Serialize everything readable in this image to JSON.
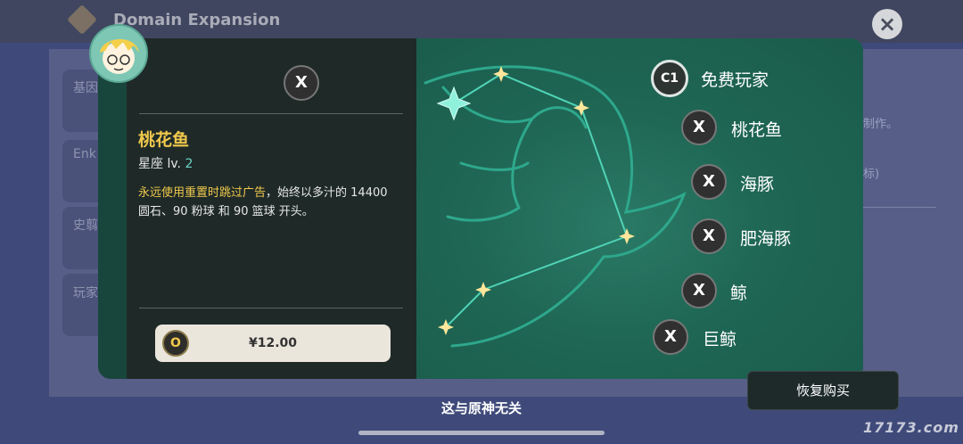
{
  "header": {
    "title": "Domain Expansion",
    "close_icon": "×"
  },
  "background": {
    "card_labels": [
      "基因",
      "Enk",
      "史翦",
      "玩家"
    ],
    "right_texts": [
      "制作。",
      "标)"
    ]
  },
  "detail": {
    "top_token": "X",
    "name": "桃花鱼",
    "level_label": "星座 lv.",
    "level_value": "2",
    "desc_highlight": "永远使用重置时跳过广告",
    "desc_rest": "，始终以多汁的 14400 圆石、90 粉球 和 90 篮球 开头。",
    "buy": {
      "token": "O",
      "price": "¥12.00"
    }
  },
  "constellation": {
    "items": [
      {
        "token": "C1",
        "label": "免费玩家"
      },
      {
        "token": "X",
        "label": "桃花鱼"
      },
      {
        "token": "X",
        "label": "海豚"
      },
      {
        "token": "X",
        "label": "肥海豚"
      },
      {
        "token": "X",
        "label": "鲸"
      },
      {
        "token": "X",
        "label": "巨鲸"
      }
    ]
  },
  "footer": {
    "restore_label": "恢复购买",
    "note": "这与原神无关",
    "watermark": "17173.com"
  },
  "colors": {
    "accent_gold": "#f0c84c",
    "teal": "#1d5548",
    "panel_dark": "#1f2a28"
  }
}
